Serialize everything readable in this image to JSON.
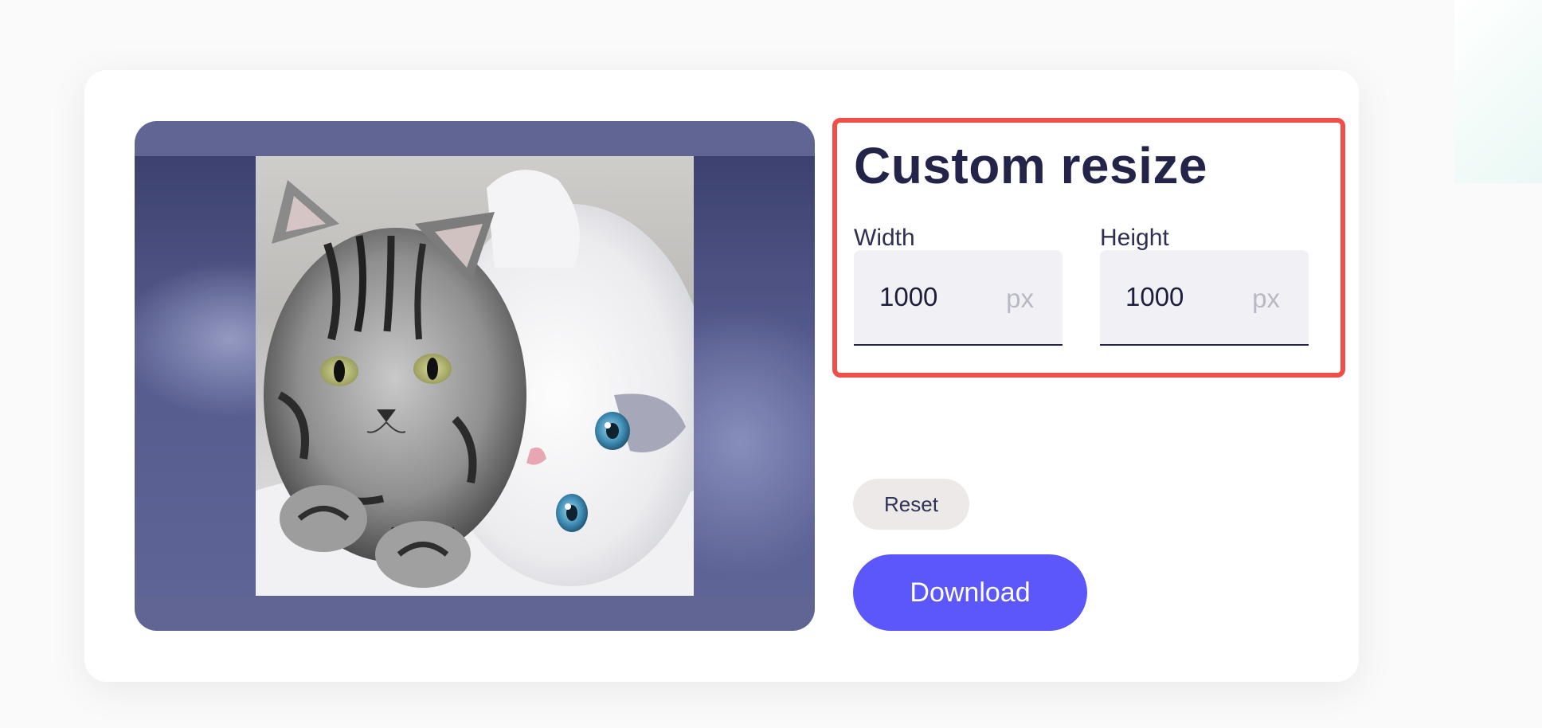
{
  "resize": {
    "title": "Custom resize",
    "width": {
      "label": "Width",
      "value": "1000",
      "unit": "px"
    },
    "height": {
      "label": "Height",
      "value": "1000",
      "unit": "px"
    }
  },
  "actions": {
    "reset_label": "Reset",
    "download_label": "Download"
  },
  "colors": {
    "accent": "#5b57fb",
    "highlight": "#ef4f4a",
    "title": "#24244a",
    "preview_frame": "#616594"
  }
}
